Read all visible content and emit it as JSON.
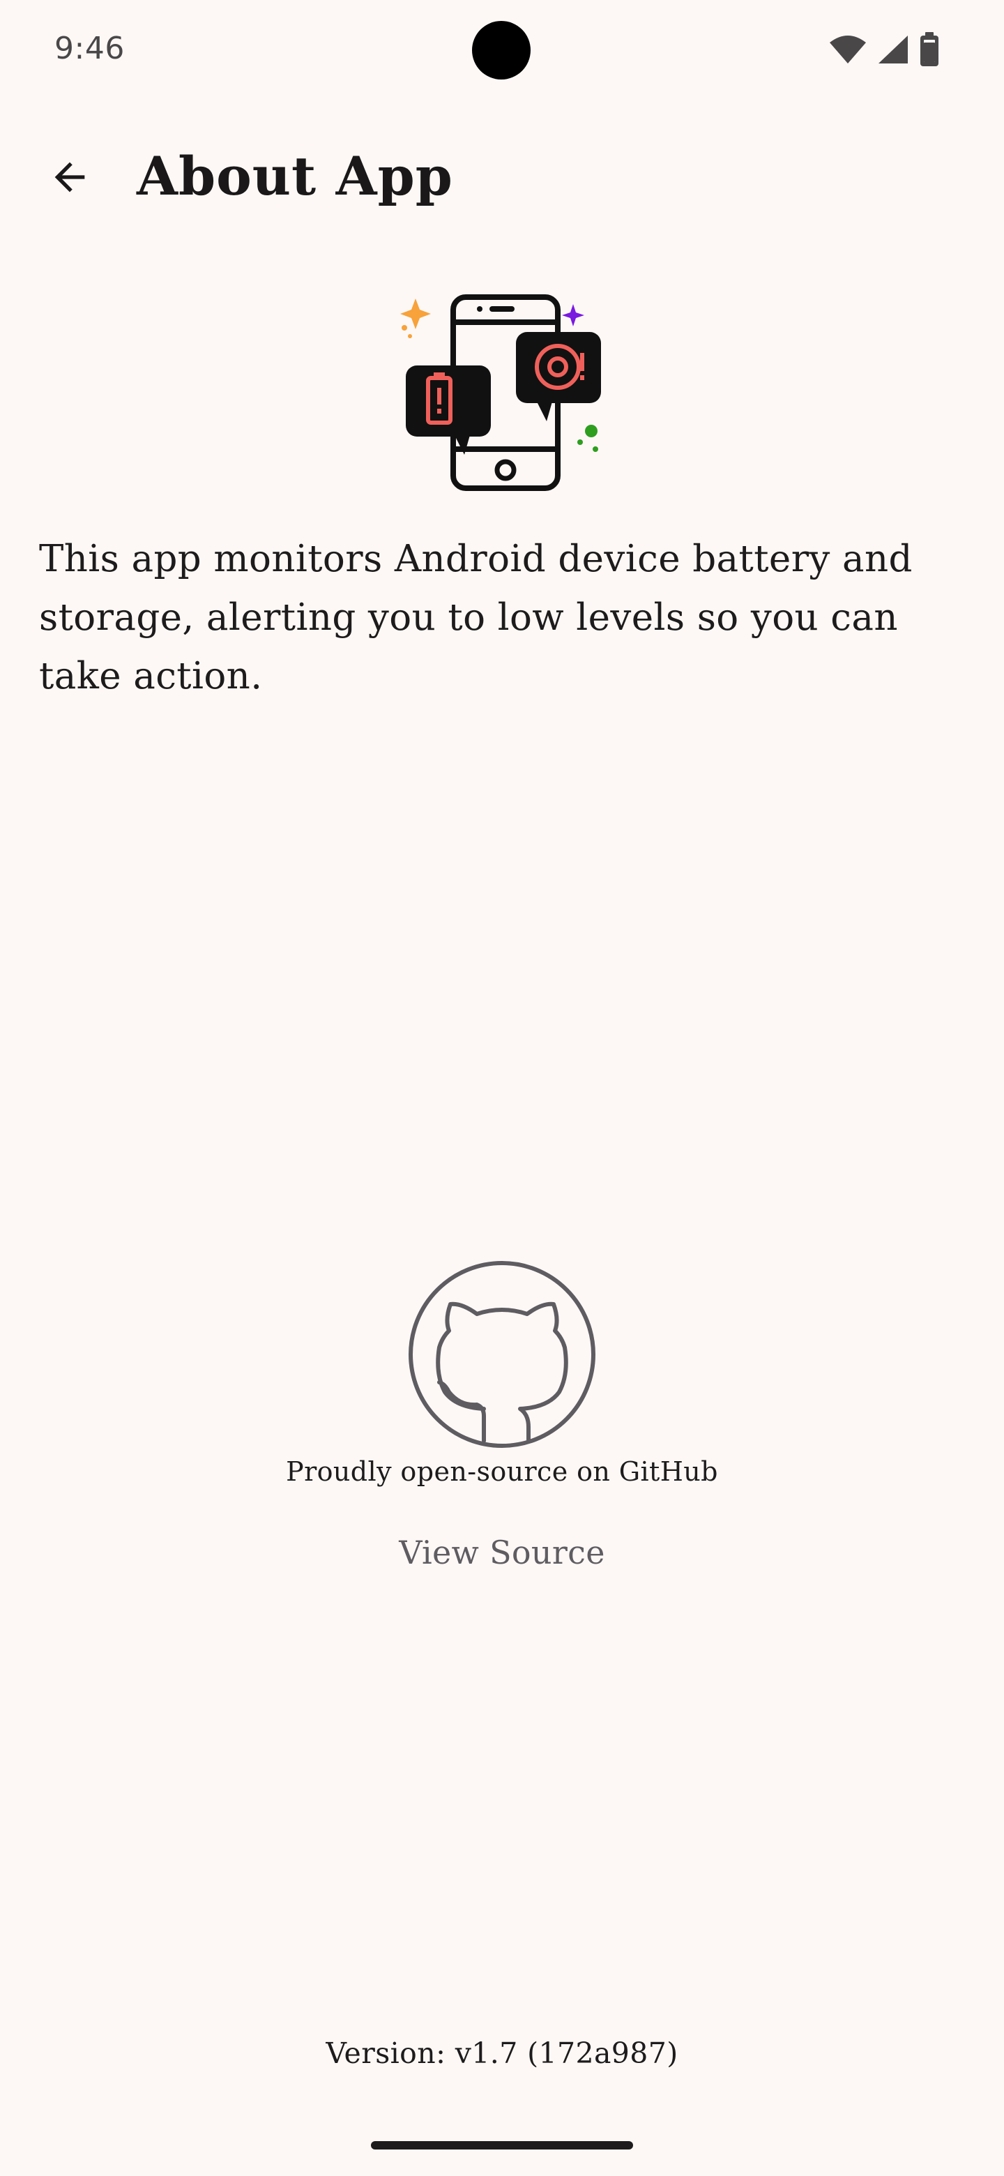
{
  "status_bar": {
    "time": "9:46",
    "icons": [
      "wifi-icon",
      "cellular-signal-icon",
      "battery-icon"
    ]
  },
  "top_bar": {
    "back_icon": "arrow-back-icon",
    "title": "About App"
  },
  "illustration": {
    "icon": "phone-alerts-illustration",
    "colors": {
      "outline": "#111111",
      "alert": "#f0605a",
      "sparkle_orange": "#f7a23a",
      "sparkle_purple": "#7a19e0",
      "dots_green": "#2e9e1f"
    }
  },
  "description": "This app monitors Android device battery and storage, alerting you to low levels so you can take action.",
  "github": {
    "icon": "github-icon",
    "caption": "Proudly open-source on GitHub",
    "view_source_label": "View Source"
  },
  "footer": {
    "version": "Version: v1.7 (172a987)"
  },
  "colors": {
    "background": "#fdf8f6",
    "text": "#1d1b1b",
    "muted": "#5f5c61"
  }
}
